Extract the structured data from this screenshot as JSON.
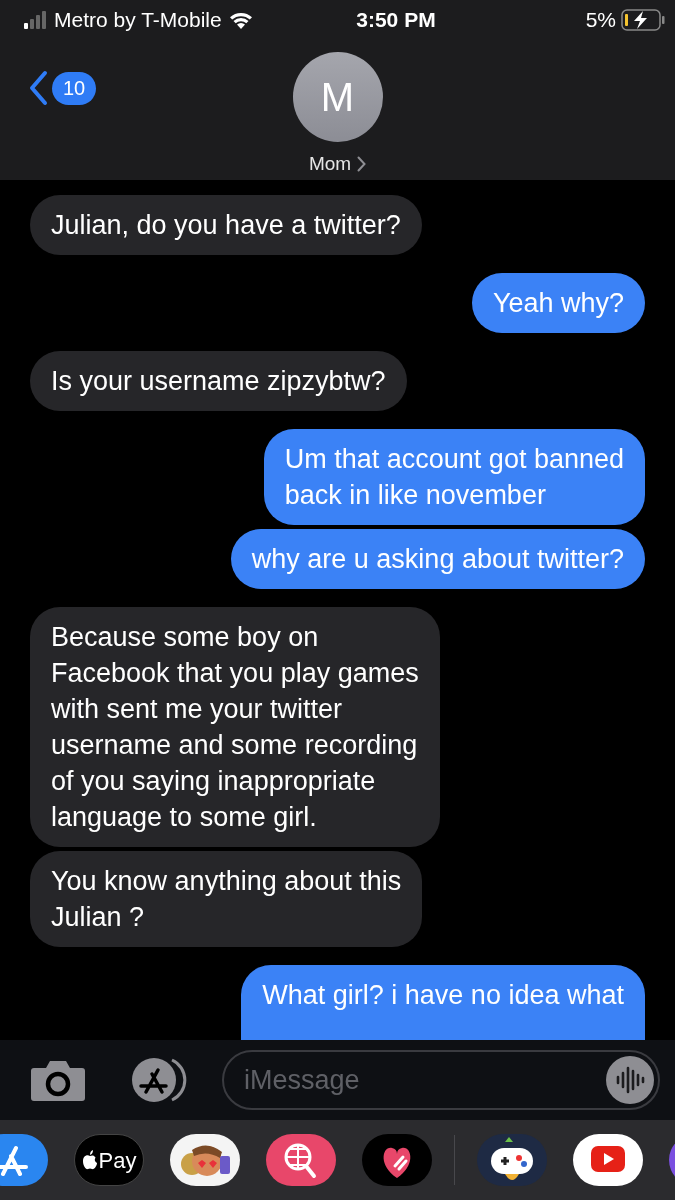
{
  "status_bar": {
    "carrier": "Metro by T-Mobile",
    "time": "3:50 PM",
    "battery": "5%"
  },
  "header": {
    "back_count": "10",
    "avatar_initial": "M",
    "name": "Mom"
  },
  "messages": [
    {
      "kind": "received",
      "text": "Julian, do you have a twitter?"
    },
    {
      "kind": "sent",
      "text": "Yeah why?"
    },
    {
      "kind": "received",
      "text": "Is your username zipzybtw?"
    },
    {
      "kind": "sent",
      "text": "Um that account got banned\nback in like november"
    },
    {
      "kind": "sent",
      "text": "why are u asking about twitter?"
    },
    {
      "kind": "received",
      "text": "Because some boy on\nFacebook that you play games\nwith sent me your twitter\nusername and some recording\nof you saying inappropriate\nlanguage to some girl."
    },
    {
      "kind": "received",
      "text": "You know anything about this\nJulian ?"
    },
    {
      "kind": "sent",
      "text": "What girl? i have no idea what"
    }
  ],
  "compose": {
    "placeholder": "iMessage"
  },
  "drawer": [
    {
      "kind": "appstore"
    },
    {
      "kind": "pay",
      "label": "Pay"
    },
    {
      "kind": "memoji"
    },
    {
      "kind": "search"
    },
    {
      "kind": "heart"
    },
    {
      "kind": "divider"
    },
    {
      "kind": "game"
    },
    {
      "kind": "video"
    },
    {
      "kind": "purple"
    }
  ]
}
